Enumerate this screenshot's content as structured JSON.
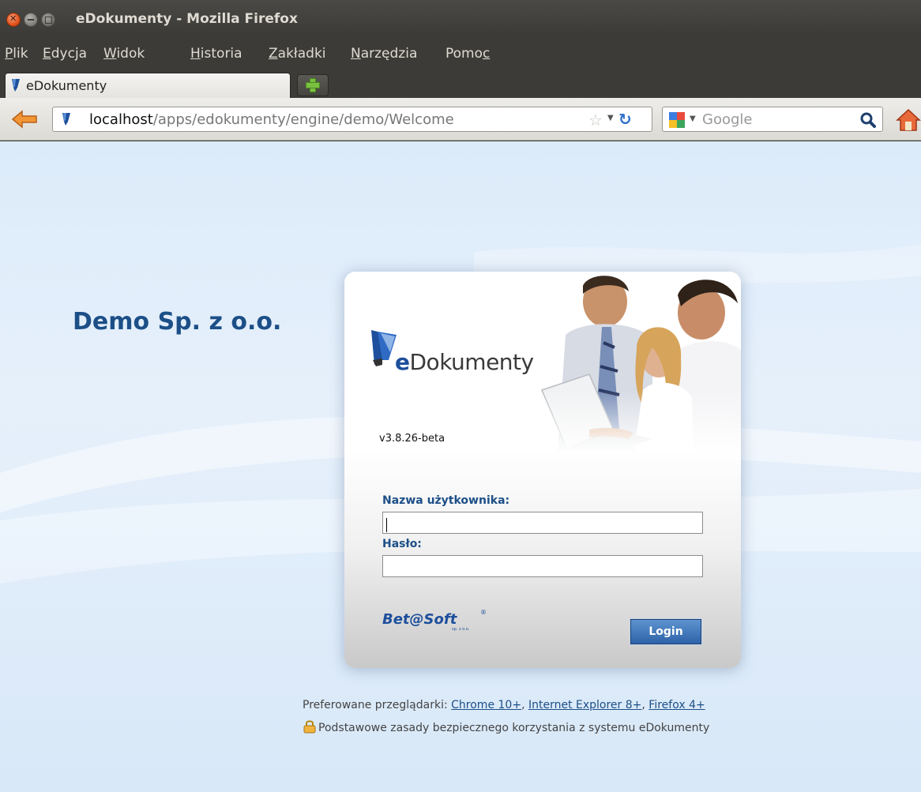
{
  "window": {
    "title": "eDokumenty - Mozilla Firefox"
  },
  "menu": {
    "items": [
      {
        "pre": "",
        "u": "P",
        "post": "lik"
      },
      {
        "pre": "",
        "u": "E",
        "post": "dycja"
      },
      {
        "pre": "",
        "u": "W",
        "post": "idok"
      },
      {
        "pre": "",
        "u": "H",
        "post": "istoria"
      },
      {
        "pre": "",
        "u": "Z",
        "post": "akładki"
      },
      {
        "pre": "",
        "u": "N",
        "post": "arzędzia"
      },
      {
        "pre": "Pomo",
        "u": "c",
        "post": ""
      }
    ]
  },
  "tab": {
    "label": "eDokumenty"
  },
  "urlbar": {
    "host": "localhost",
    "path": "/apps/edokumenty/engine/demo/Welcome"
  },
  "search": {
    "placeholder": "Google"
  },
  "page": {
    "company": "Demo Sp. z o.o.",
    "logo_e": "e",
    "logo_rest": "Dokumenty",
    "version": "v3.8.26-beta",
    "username_label": "Nazwa użytkownika:",
    "username_value": "",
    "password_label": "Hasło:",
    "password_value": "",
    "vendor_logo": "Bet@Soft",
    "login_label": "Login",
    "preferred_prefix": "Preferowane przeglądarki:",
    "browser_links": [
      "Chrome 10+",
      "Internet Explorer 8+",
      "Firefox 4+"
    ],
    "safety_text": "Podstawowe zasady bezpiecznego korzystania z systemu eDokumenty"
  },
  "colors": {
    "accent": "#1c4f87",
    "login_button": "#3a6fb0",
    "titlebar": "#3c3b37"
  }
}
